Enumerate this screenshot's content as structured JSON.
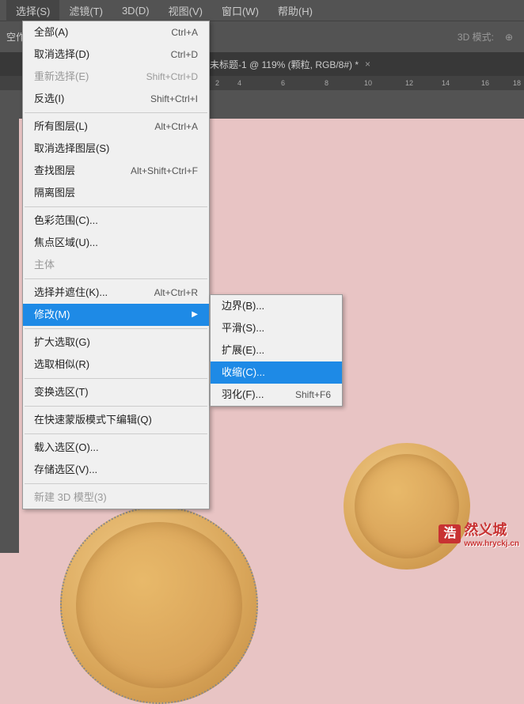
{
  "menubar": {
    "items": [
      {
        "label": "选择(S)",
        "active": true
      },
      {
        "label": "滤镜(T)"
      },
      {
        "label": "3D(D)"
      },
      {
        "label": "视图(V)"
      },
      {
        "label": "窗口(W)"
      },
      {
        "label": "帮助(H)"
      }
    ]
  },
  "toolbar": {
    "left_label": "空作",
    "mode3d_label": "3D 模式:"
  },
  "tab": {
    "title": "未标题-1 @ 119% (颗粒, RGB/8#) *",
    "close": "×"
  },
  "ruler": {
    "marks": [
      "2",
      "4",
      "6",
      "8",
      "10",
      "12",
      "14",
      "16",
      "18"
    ]
  },
  "dropdown": [
    {
      "label": "全部(A)",
      "shortcut": "Ctrl+A"
    },
    {
      "label": "取消选择(D)",
      "shortcut": "Ctrl+D"
    },
    {
      "label": "重新选择(E)",
      "shortcut": "Shift+Ctrl+D",
      "disabled": true
    },
    {
      "label": "反选(I)",
      "shortcut": "Shift+Ctrl+I"
    },
    {
      "sep": true
    },
    {
      "label": "所有图层(L)",
      "shortcut": "Alt+Ctrl+A"
    },
    {
      "label": "取消选择图层(S)"
    },
    {
      "label": "查找图层",
      "shortcut": "Alt+Shift+Ctrl+F"
    },
    {
      "label": "隔离图层"
    },
    {
      "sep": true
    },
    {
      "label": "色彩范围(C)..."
    },
    {
      "label": "焦点区域(U)..."
    },
    {
      "label": "主体",
      "disabled": true
    },
    {
      "sep": true
    },
    {
      "label": "选择并遮住(K)...",
      "shortcut": "Alt+Ctrl+R"
    },
    {
      "label": "修改(M)",
      "highlight": true,
      "submenu": true
    },
    {
      "sep": true
    },
    {
      "label": "扩大选取(G)"
    },
    {
      "label": "选取相似(R)"
    },
    {
      "sep": true
    },
    {
      "label": "变换选区(T)"
    },
    {
      "sep": true
    },
    {
      "label": "在快速蒙版模式下编辑(Q)"
    },
    {
      "sep": true
    },
    {
      "label": "载入选区(O)..."
    },
    {
      "label": "存储选区(V)..."
    },
    {
      "sep": true
    },
    {
      "label": "新建 3D 模型(3)",
      "disabled": true
    }
  ],
  "submenu": [
    {
      "label": "边界(B)..."
    },
    {
      "label": "平滑(S)..."
    },
    {
      "label": "扩展(E)..."
    },
    {
      "label": "收缩(C)...",
      "highlight": true
    },
    {
      "label": "羽化(F)...",
      "shortcut": "Shift+F6"
    }
  ],
  "watermark": {
    "box": "浩",
    "text": "然义城",
    "url": "www.hryckj.cn"
  }
}
